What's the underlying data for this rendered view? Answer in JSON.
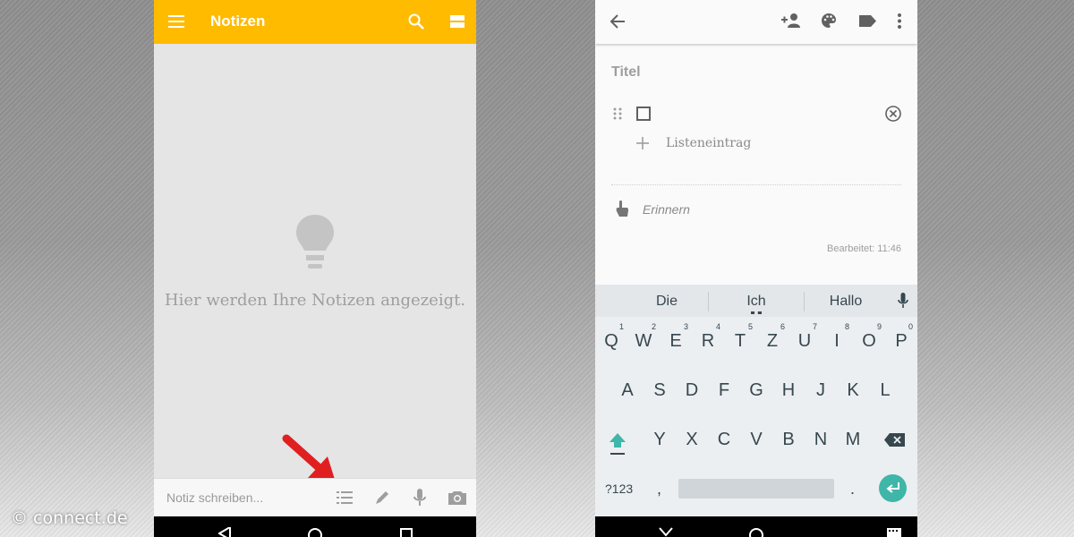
{
  "left_screen": {
    "title": "Notizen",
    "empty_message": "Hier werden Ihre Notizen angezeigt.",
    "input_placeholder": "Notiz schreiben...",
    "appbar_color": "#ffbb00",
    "icons": [
      "menu-icon",
      "search-icon",
      "view-toggle-icon",
      "lightbulb-icon",
      "checklist-icon",
      "pen-icon",
      "mic-icon",
      "camera-icon"
    ]
  },
  "right_screen": {
    "title_placeholder": "Titel",
    "list_item_add": "Listeneintrag",
    "remind": "Erinnern",
    "edited": "Bearbeitet: 11:46",
    "icons": [
      "back-icon",
      "add-person-icon",
      "palette-icon",
      "label-icon",
      "more-icon",
      "drag-handle-icon",
      "checkbox-icon",
      "remove-icon",
      "plus-icon",
      "reminder-icon"
    ]
  },
  "keyboard": {
    "suggestions": [
      "Die",
      "Ich",
      "Hallo"
    ],
    "row1": [
      "Q",
      "W",
      "E",
      "R",
      "T",
      "Z",
      "U",
      "I",
      "O",
      "P"
    ],
    "row1_numbers": [
      "1",
      "2",
      "3",
      "4",
      "5",
      "6",
      "7",
      "8",
      "9",
      "0"
    ],
    "row2": [
      "A",
      "S",
      "D",
      "F",
      "G",
      "H",
      "J",
      "K",
      "L"
    ],
    "row3": [
      "Y",
      "X",
      "C",
      "V",
      "B",
      "N",
      "M"
    ],
    "symbols_key": "?123",
    "comma": ",",
    "period": ".",
    "accent_color": "#3fb6a8"
  },
  "watermark": "© connect.de"
}
